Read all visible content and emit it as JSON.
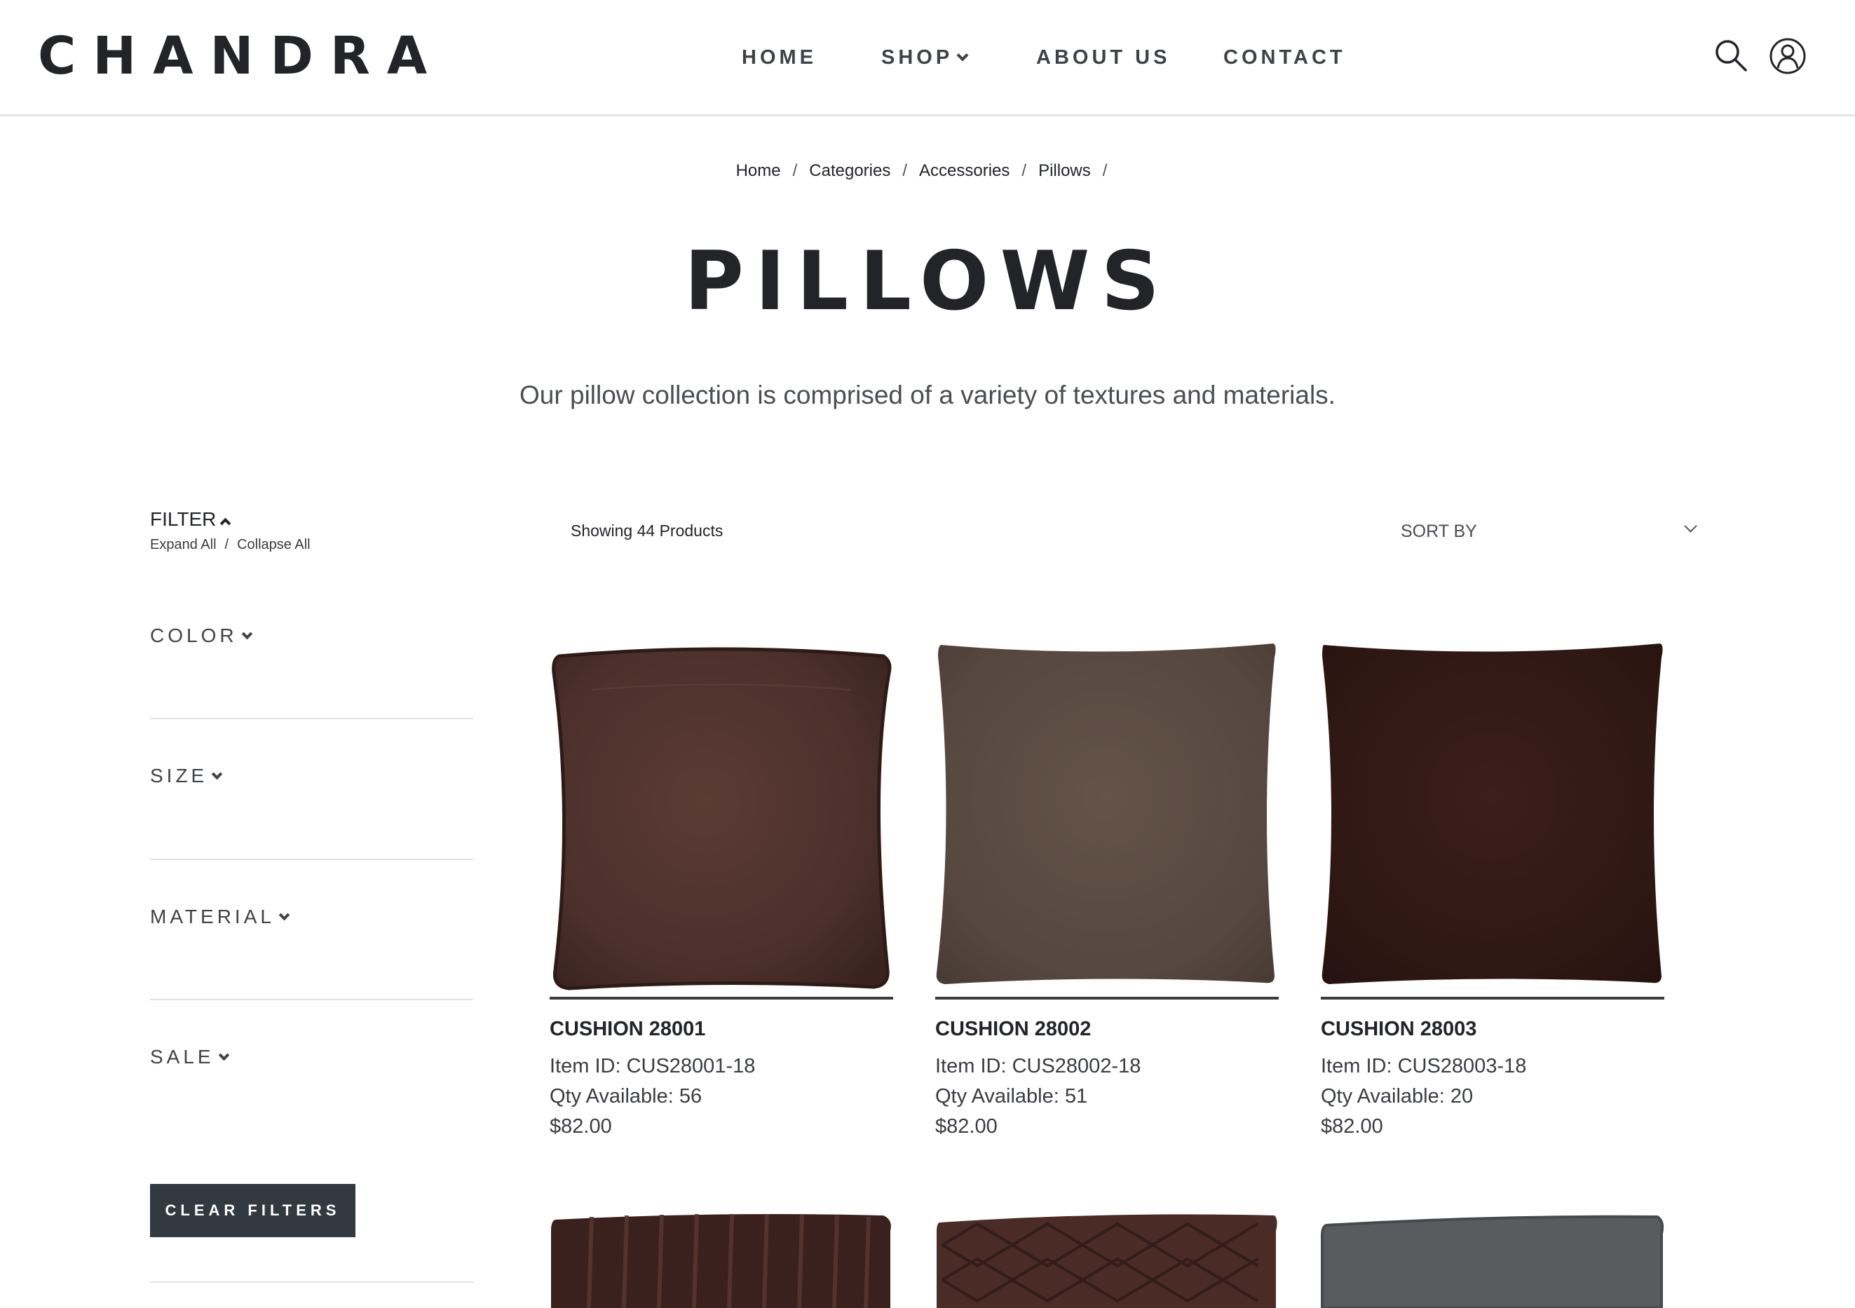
{
  "header": {
    "logo": "CHANDRA",
    "nav": {
      "home": "HOME",
      "shop": "SHOP",
      "about": "ABOUT US",
      "contact": "CONTACT"
    }
  },
  "breadcrumb": [
    "Home",
    "Categories",
    "Accessories",
    "Pillows"
  ],
  "page": {
    "title": "PILLOWS",
    "description": "Our pillow collection is comprised of a variety of textures and materials."
  },
  "filter": {
    "label": "FILTER",
    "expand_all": "Expand All",
    "collapse_all": "Collapse All",
    "facets": [
      "COLOR",
      "SIZE",
      "MATERIAL",
      "SALE"
    ],
    "clear_button": "CLEAR FILTERS"
  },
  "toolbar": {
    "showing": "Showing 44 Products",
    "sort_label": "SORT BY"
  },
  "products": [
    {
      "name": "CUSHION 28001",
      "item_id": "Item ID: CUS28001-18",
      "qty": "Qty Available: 56",
      "price": "$82.00",
      "color": "#4b302b"
    },
    {
      "name": "CUSHION 28002",
      "item_id": "Item ID: CUS28002-18",
      "qty": "Qty Available: 51",
      "price": "$82.00",
      "color": "#56483f"
    },
    {
      "name": "CUSHION 28003",
      "item_id": "Item ID: CUS28003-18",
      "qty": "Qty Available: 20",
      "price": "$82.00",
      "color": "#2f1713"
    }
  ],
  "colors": {
    "text": "#222428",
    "button_bg": "#333940",
    "divider": "#e2e2e2"
  },
  "icons": {
    "search": "search-icon",
    "account": "user-account-icon"
  }
}
